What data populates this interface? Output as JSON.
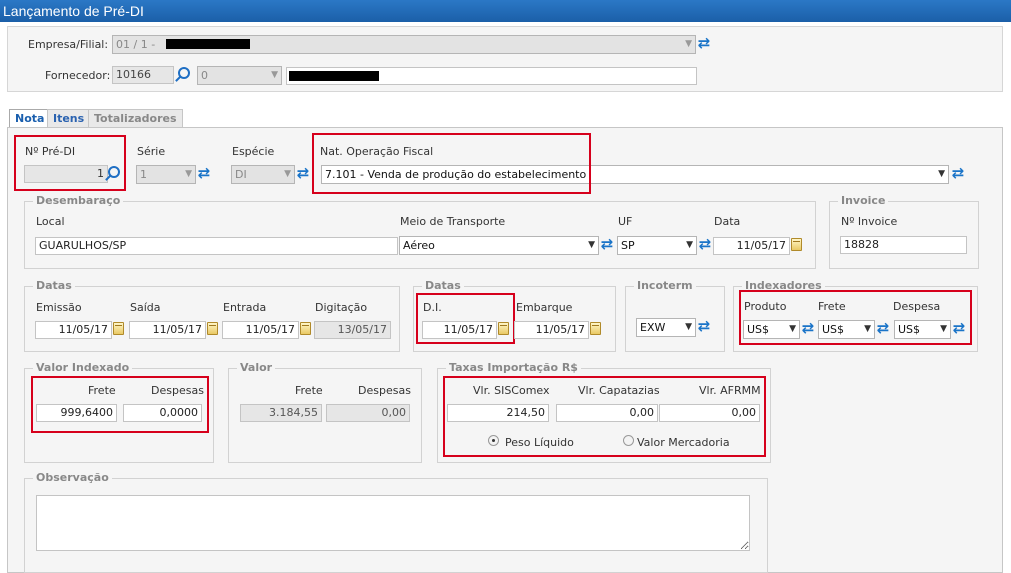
{
  "window": {
    "title": "Lançamento de Pré-DI"
  },
  "header": {
    "empresa_label": "Empresa/Filial:",
    "empresa_value": "01 / 1 -",
    "fornecedor_label": "Fornecedor:",
    "fornecedor_code": "10166",
    "fornecedor_select": "0"
  },
  "tabs": [
    {
      "label": "Nota"
    },
    {
      "label": "Itens"
    },
    {
      "label": "Totalizadores"
    }
  ],
  "nota": {
    "npre_label": "Nº Pré-DI",
    "npre_value": "1",
    "serie_label": "Série",
    "serie_value": "1",
    "especie_label": "Espécie",
    "especie_value": "DI",
    "natop_label": "Nat. Operação Fiscal",
    "natop_value": "7.101 - Venda de produção do estabelecimento"
  },
  "desembaraco": {
    "legend": "Desembaraço",
    "local_label": "Local",
    "local_value": "GUARULHOS/SP",
    "meio_label": "Meio de Transporte",
    "meio_value": "Aéreo",
    "uf_label": "UF",
    "uf_value": "SP",
    "data_label": "Data",
    "data_value": "11/05/17"
  },
  "invoice": {
    "legend": "Invoice",
    "num_label": "Nº Invoice",
    "num_value": "18828"
  },
  "datas": {
    "legend": "Datas",
    "emissao_label": "Emissão",
    "emissao_value": "11/05/17",
    "saida_label": "Saída",
    "saida_value": "11/05/17",
    "entrada_label": "Entrada",
    "entrada_value": "11/05/17",
    "digitacao_label": "Digitação",
    "digitacao_value": "13/05/17"
  },
  "datas2": {
    "legend": "Datas",
    "di_label": "D.I.",
    "di_value": "11/05/17",
    "embarque_label": "Embarque",
    "embarque_value": "11/05/17"
  },
  "incoterm": {
    "legend": "Incoterm",
    "value": "EXW"
  },
  "indexadores": {
    "legend": "Indexadores",
    "produto_label": "Produto",
    "produto_value": "US$",
    "frete_label": "Frete",
    "frete_value": "US$",
    "despesa_label": "Despesa",
    "despesa_value": "US$"
  },
  "valor_indexado": {
    "legend": "Valor Indexado",
    "frete_label": "Frete",
    "frete_value": "999,6400",
    "despesas_label": "Despesas",
    "despesas_value": "0,0000"
  },
  "valor": {
    "legend": "Valor",
    "frete_label": "Frete",
    "frete_value": "3.184,55",
    "despesas_label": "Despesas",
    "despesas_value": "0,00"
  },
  "taxas": {
    "legend": "Taxas Importação R$",
    "siscomex_label": "Vlr. SISComex",
    "siscomex_value": "214,50",
    "capatazias_label": "Vlr. Capatazias",
    "capatazias_value": "0,00",
    "afrmm_label": "Vlr. AFRMM",
    "afrmm_value": "0,00",
    "radio_peso": "Peso Líquido",
    "radio_mercadoria": "Valor Mercadoria"
  },
  "observacao": {
    "legend": "Observação"
  },
  "colors": {
    "accent": "#1b5fa8",
    "highlight": "#d6001c"
  }
}
